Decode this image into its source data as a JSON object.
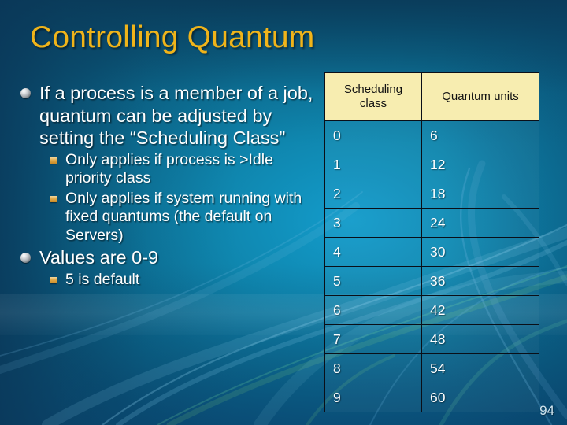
{
  "slide": {
    "title": "Controlling Quantum",
    "page_number": "94",
    "colors": {
      "title": "#f0b41a",
      "body_text": "#ffffff",
      "table_header_bg": "#f7edb0",
      "table_header_text": "#111111",
      "background_dark": "#0a4e70",
      "background_light": "#139ccb",
      "sub_bullet": "#e0a94a"
    }
  },
  "body": {
    "bullets": [
      {
        "level": 1,
        "marker": "pearl-sphere-bullet",
        "text": "If a process is a member of a job, quantum can be adjusted by setting the “Scheduling Class”"
      },
      {
        "level": 2,
        "marker": "gold-square-bullet",
        "text": "Only applies if process is >Idle priority class"
      },
      {
        "level": 2,
        "marker": "gold-square-bullet",
        "text": "Only applies if system running with fixed quantums (the default on Servers)"
      },
      {
        "level": 1,
        "marker": "pearl-sphere-bullet",
        "text": "Values are 0-9"
      },
      {
        "level": 2,
        "marker": "gold-square-bullet",
        "text": "5 is default"
      }
    ]
  },
  "table": {
    "headers": [
      "Scheduling class",
      "Quantum units"
    ],
    "rows": [
      [
        "0",
        "6"
      ],
      [
        "1",
        "12"
      ],
      [
        "2",
        "18"
      ],
      [
        "3",
        "24"
      ],
      [
        "4",
        "30"
      ],
      [
        "5",
        "36"
      ],
      [
        "6",
        "42"
      ],
      [
        "7",
        "48"
      ],
      [
        "8",
        "54"
      ],
      [
        "9",
        "60"
      ]
    ]
  },
  "chart_data": {
    "type": "table",
    "title": "Scheduling class to quantum units mapping",
    "columns": [
      "Scheduling class",
      "Quantum units"
    ],
    "categories": [
      "0",
      "1",
      "2",
      "3",
      "4",
      "5",
      "6",
      "7",
      "8",
      "9"
    ],
    "values": [
      6,
      12,
      18,
      24,
      30,
      36,
      42,
      48,
      54,
      60
    ],
    "xlabel": "Scheduling class",
    "ylabel": "Quantum units"
  }
}
